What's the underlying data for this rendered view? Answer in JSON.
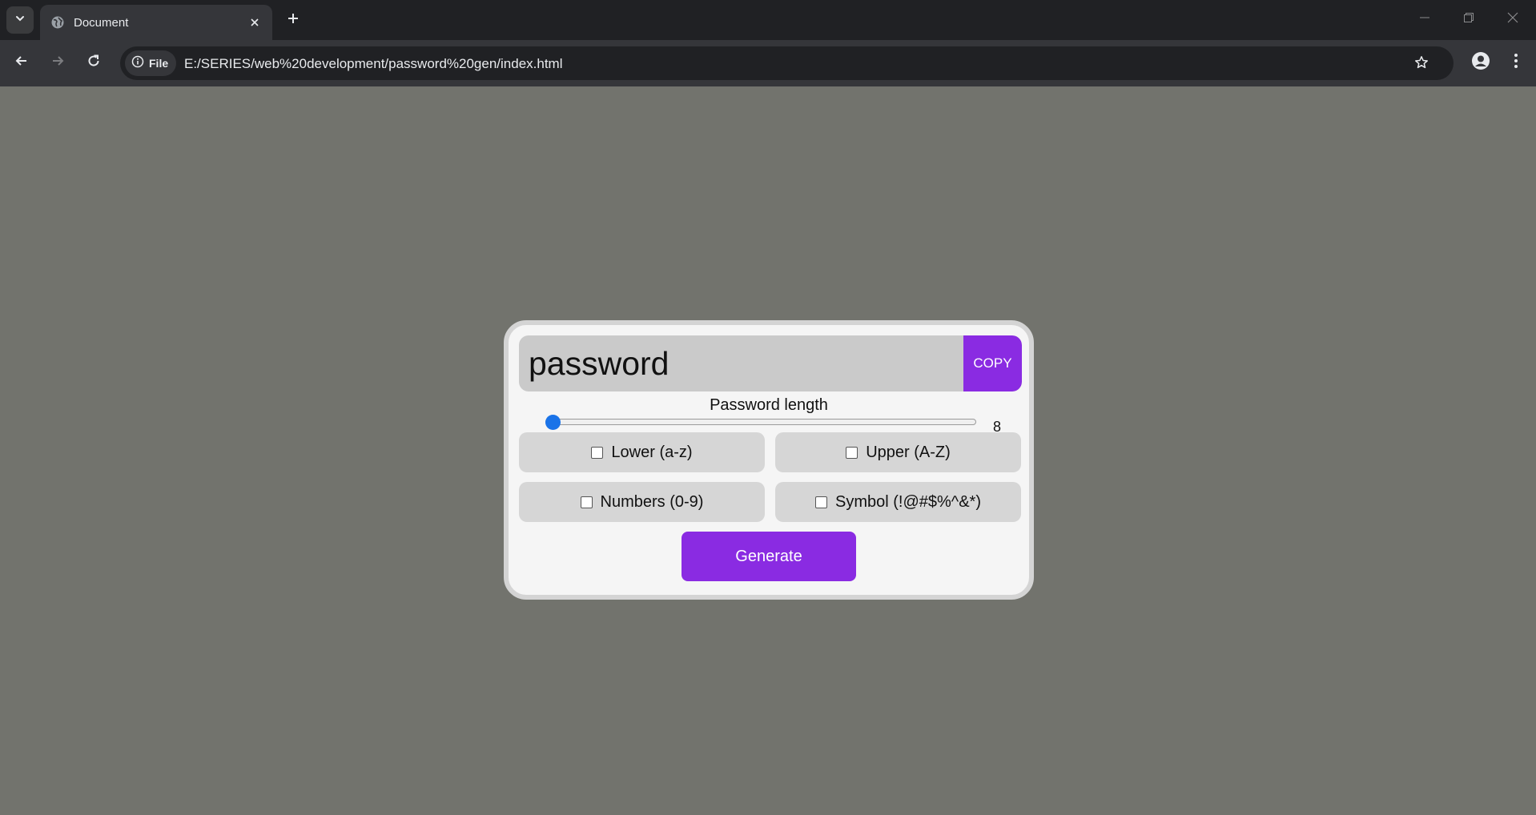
{
  "browser": {
    "tab_title": "Document",
    "site_chip_label": "File",
    "url": "E:/SERIES/web%20development/password%20gen/index.html"
  },
  "app": {
    "password_display": "password",
    "copy_label": "COPY",
    "length_label": "Password length",
    "length_value": "8",
    "length_slider_fraction": 0,
    "options": [
      {
        "label": "Lower (a-z)",
        "checked": false
      },
      {
        "label": "Upper (A-Z)",
        "checked": false
      },
      {
        "label": "Numbers (0-9)",
        "checked": false
      },
      {
        "label": "Symbol (!@#$%^&*)",
        "checked": false
      }
    ],
    "generate_label": "Generate"
  },
  "colors": {
    "page_background": "#72736d",
    "accent": "#8a2be2",
    "slider": "#1a73e8"
  },
  "icons": [
    "tab-search-icon",
    "globe-icon",
    "close-icon",
    "plus-icon",
    "minimize-icon",
    "restore-icon",
    "window-close-icon",
    "back-arrow-icon",
    "forward-arrow-icon",
    "reload-icon",
    "info-icon",
    "star-icon",
    "profile-icon",
    "kebab-menu-icon"
  ]
}
